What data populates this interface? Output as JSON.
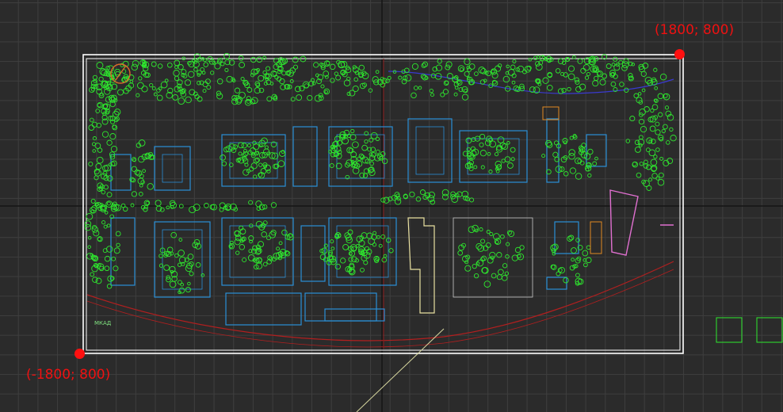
{
  "viewport": {
    "background": "#2b2b2b",
    "grid_color": "#3e3e3e",
    "crosshair_color": "#141414"
  },
  "corner_markers": {
    "top_right": {
      "label": "(1800; 800)",
      "color": "#ff1010"
    },
    "bottom_left": {
      "label": "(-1800; 800)",
      "color": "#ff1010"
    }
  },
  "drawing": {
    "frame_color": "#ffffff",
    "tree_color": "#2ee82e",
    "building_color": "#2a8fd6",
    "road_color": "#b21f1f",
    "label_color": "#7fe07f",
    "street_labels": [
      "МКАД"
    ],
    "legend_boxes": 2
  }
}
